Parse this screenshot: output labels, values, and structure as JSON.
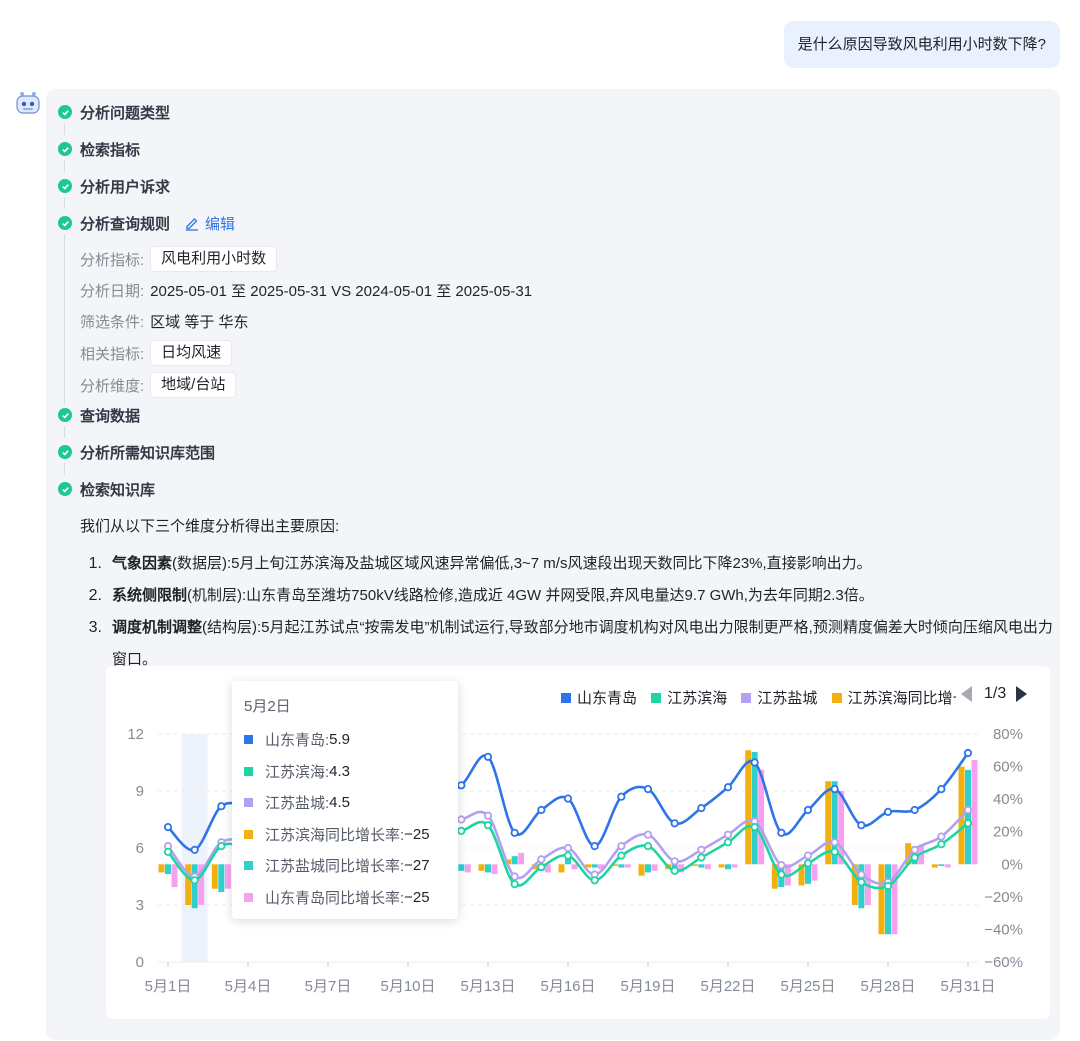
{
  "question": "是什么原因导致风电利用小时数下降?",
  "steps": [
    {
      "label": "分析问题类型"
    },
    {
      "label": "检索指标"
    },
    {
      "label": "分析用户诉求"
    },
    {
      "label": "分析查询规则",
      "edit_label": "编辑"
    },
    {
      "label": "查询数据"
    },
    {
      "label": "分析所需知识库范围"
    },
    {
      "label": "检索知识库"
    }
  ],
  "rules": {
    "metric": {
      "key": "分析指标:",
      "value": "风电利用小时数"
    },
    "date": {
      "key": "分析日期:",
      "value": "2025-05-01 至 2025-05-31 VS 2024-05-01 至 2025-05-31"
    },
    "filter": {
      "key": "筛选条件:",
      "value": "区域 等于 华东"
    },
    "related": {
      "key": "相关指标:",
      "value": "日均风速"
    },
    "dimension": {
      "key": "分析维度:",
      "value": "地域/台站"
    }
  },
  "summary": {
    "intro": "我们从以下三个维度分析得出主要原因:",
    "reasons": [
      {
        "num": "1.",
        "title": "气象因素",
        "layer": "(数据层)",
        "text": ":5月上旬江苏滨海及盐城区域风速异常偏低,3~7 m/s风速段出现天数同比下降23%,直接影响出力。"
      },
      {
        "num": "2.",
        "title": "系统侧限制",
        "layer": "(机制层)",
        "text": ":山东青岛至潍坊750kV线路检修,造成近 4GW 并网受限,弃风电量达9.7 GWh,为去年同期2.3倍。"
      },
      {
        "num": "3.",
        "title": "调度机制调整",
        "layer": "(结构层)",
        "text": ":5月起江苏试点“按需发电”机制试运行,导致部分地市调度机构对风电出力限制更严格,预测精度偏差大时倾向压缩风电出力窗口。"
      }
    ]
  },
  "legend": {
    "items": [
      "山东青岛",
      "江苏滨海",
      "江苏盐城",
      "江苏滨海同比增长率"
    ],
    "page": "1/3"
  },
  "tooltip": {
    "title": "5月2日",
    "rows": [
      {
        "label": "山东青岛:",
        "value": "5.9",
        "color": "#2f74e8"
      },
      {
        "label": "江苏滨海:",
        "value": "4.3",
        "color": "#1ed4a3"
      },
      {
        "label": "江苏盐城:",
        "value": "4.5",
        "color": "#b3a0f0"
      },
      {
        "label": "江苏滨海同比增长率:",
        "value": "−25",
        "color": "#f2b10e"
      },
      {
        "label": "江苏盐城同比增长率:",
        "value": "−27",
        "color": "#2fd0cc"
      },
      {
        "label": "山东青岛同比增长率:",
        "value": "−25",
        "color": "#f6a1ee"
      }
    ]
  },
  "chart_data": {
    "type": "line",
    "x": [
      "5月1日",
      "5月2日",
      "5月3日",
      "5月4日",
      "5月5日",
      "5月6日",
      "5月7日",
      "5月8日",
      "5月9日",
      "5月10日",
      "5月11日",
      "5月12日",
      "5月13日",
      "5月14日",
      "5月15日",
      "5月16日",
      "5月17日",
      "5月18日",
      "5月19日",
      "5月20日",
      "5月21日",
      "5月22日",
      "5月23日",
      "5月24日",
      "5月25日",
      "5月26日",
      "5月27日",
      "5月28日",
      "5月29日",
      "5月30日",
      "5月31日"
    ],
    "x_tick_labels": [
      "5月1日",
      "5月4日",
      "5月7日",
      "5月10日",
      "5月13日",
      "5月16日",
      "5月19日",
      "5月22日",
      "5月25日",
      "5月28日",
      "5月31日"
    ],
    "y_left": {
      "ticks": [
        "0",
        "3",
        "6",
        "9",
        "12"
      ],
      "ylim": [
        0,
        12
      ]
    },
    "y_right": {
      "ticks": [
        "−60%",
        "−40%",
        "−20%",
        "0%",
        "20%",
        "40%",
        "60%",
        "80%"
      ],
      "ylim": [
        -60,
        80
      ]
    },
    "highlight_x": "5月2日",
    "series": [
      {
        "name": "山东青岛",
        "axis": "left",
        "color": "#2f74e8",
        "values": [
          7.1,
          5.9,
          8.2,
          8.1,
          7.4,
          7.6,
          7.8,
          7.9,
          8.2,
          8.5,
          8.7,
          9.3,
          10.8,
          6.8,
          8.0,
          8.6,
          6.1,
          8.7,
          9.1,
          7.3,
          8.1,
          9.2,
          10.5,
          6.8,
          8.0,
          9.1,
          7.2,
          7.9,
          8.0,
          9.1,
          11.0
        ]
      },
      {
        "name": "江苏滨海",
        "axis": "left",
        "color": "#1ed4a3",
        "values": [
          5.8,
          4.3,
          6.1,
          6.0,
          5.6,
          5.7,
          5.8,
          5.9,
          6.0,
          6.3,
          6.6,
          6.9,
          7.2,
          4.1,
          5.0,
          5.6,
          4.3,
          5.6,
          6.1,
          4.8,
          5.5,
          6.3,
          7.1,
          4.6,
          5.2,
          5.8,
          4.2,
          4.0,
          5.5,
          6.2,
          7.3
        ]
      },
      {
        "name": "江苏盐城",
        "axis": "left",
        "color": "#b3a0f0",
        "values": [
          6.1,
          4.5,
          6.3,
          6.3,
          5.9,
          6.0,
          6.1,
          6.2,
          6.3,
          6.7,
          7.1,
          7.5,
          7.7,
          4.5,
          5.4,
          6.0,
          4.6,
          6.1,
          6.7,
          5.3,
          5.9,
          6.7,
          7.4,
          5.1,
          5.6,
          6.3,
          4.6,
          4.2,
          5.9,
          6.6,
          8.0
        ]
      },
      {
        "name": "江苏滨海同比增长率",
        "axis": "right",
        "color": "#f2b10e",
        "values": [
          -5,
          -25,
          -15,
          -12,
          -5,
          -4,
          -3,
          -4,
          -2,
          -1,
          -2,
          -3,
          -4,
          3,
          -3,
          -5,
          -2,
          -1,
          -7,
          -3,
          -1,
          -2,
          70,
          -15,
          -13,
          51,
          -25,
          -43,
          13,
          -2,
          60
        ]
      },
      {
        "name": "江苏盐城同比增长率",
        "axis": "right",
        "color": "#2fd0cc",
        "values": [
          -6,
          -27,
          -17,
          -13,
          -6,
          -5,
          -4,
          -5,
          -3,
          -2,
          -3,
          -4,
          -5,
          5,
          -4,
          5,
          -2,
          -2,
          -5,
          -4,
          -2,
          -3,
          69,
          -14,
          -12,
          51,
          -27,
          -43,
          11,
          -1,
          58
        ]
      },
      {
        "name": "山东青岛同比增长率",
        "axis": "right",
        "color": "#f6a1ee",
        "values": [
          -14,
          -25,
          -15,
          -14,
          -8,
          -6,
          -5,
          -6,
          -4,
          -3,
          -4,
          -5,
          -6,
          7,
          -5,
          -3,
          -3,
          -2,
          -4,
          -5,
          -3,
          -2,
          58,
          -13,
          -10,
          45,
          -25,
          -43,
          12,
          -2,
          64
        ]
      }
    ]
  }
}
